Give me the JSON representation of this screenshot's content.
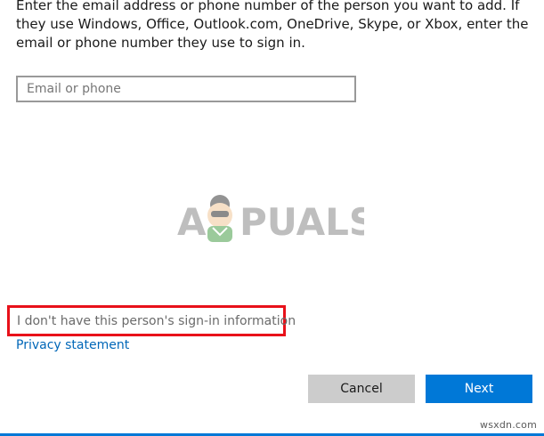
{
  "intro": {
    "text": "Enter the email address or phone number of the person you want to add. If they use Windows, Office, Outlook.com, OneDrive, Skype, or Xbox, enter the email or phone number they use to sign in."
  },
  "email_field": {
    "placeholder": "Email or phone",
    "value": ""
  },
  "watermark": {
    "brand_a": "A",
    "brand_rest": "PUALS"
  },
  "links": {
    "no_signin_info": "I don't have this person's sign-in information",
    "privacy": "Privacy statement"
  },
  "buttons": {
    "cancel": "Cancel",
    "next": "Next"
  },
  "footer": {
    "site": "wsxdn.com"
  },
  "colors": {
    "accent": "#0078d7",
    "link": "#0067b8",
    "highlight_box": "#e8111a",
    "cancel_bg": "#cccccc"
  }
}
